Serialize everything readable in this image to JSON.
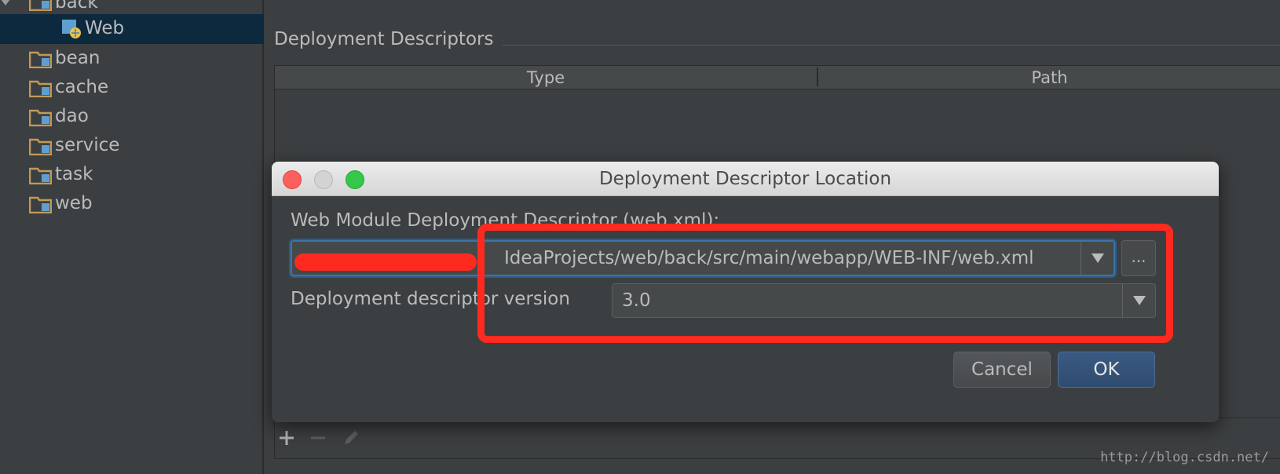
{
  "tree": {
    "items": [
      {
        "label": "back",
        "kind": "folder",
        "expanded": true
      },
      {
        "label": "Web",
        "kind": "web-facet",
        "selected": true
      },
      {
        "label": "bean",
        "kind": "folder"
      },
      {
        "label": "cache",
        "kind": "folder"
      },
      {
        "label": "dao",
        "kind": "folder"
      },
      {
        "label": "service",
        "kind": "folder"
      },
      {
        "label": "task",
        "kind": "folder"
      },
      {
        "label": "web",
        "kind": "folder"
      }
    ]
  },
  "section": {
    "title": "Deployment Descriptors",
    "columns": [
      "Type",
      "Path"
    ]
  },
  "toolbar": {
    "icons": [
      "plus-icon",
      "minus-icon",
      "pencil-icon"
    ]
  },
  "dialog": {
    "title": "Deployment Descriptor Location",
    "descriptor_label": "Web Module Deployment Descriptor (web.xml):",
    "path_value": "IdeaProjects/web/back/src/main/webapp/WEB-INF/web.xml",
    "browse_label": "...",
    "version_label": "Deployment descriptor version",
    "version_value": "3.0",
    "cancel_label": "Cancel",
    "ok_label": "OK"
  },
  "watermark": "http://blog.csdn.net/",
  "colors": {
    "background": "#3c3f41",
    "selection": "#0d293e",
    "annotation_red": "#ff2a1f",
    "ok_button": "#365880",
    "folder": "#c19a58"
  }
}
